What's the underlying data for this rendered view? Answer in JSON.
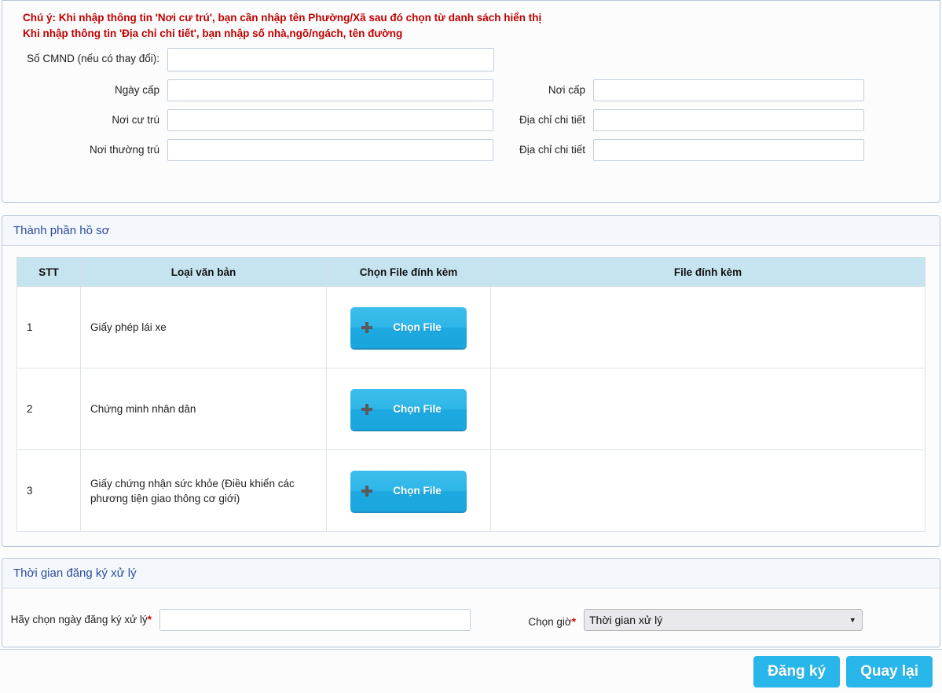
{
  "notice": {
    "line1": "Chú ý: Khi nhập thông tin 'Nơi cư trú', bạn cần nhập tên Phường/Xã sau đó chọn từ danh sách hiển thị",
    "line2": "Khi nhập thông tin 'Địa chỉ chi tiết', bạn nhập số nhà,ngõ/ngách, tên đường",
    "color": "#c00000"
  },
  "personal_form": {
    "fields": [
      {
        "label": "Số CMND (nếu có thay đổi):",
        "value": "",
        "placeholder": ""
      },
      {
        "label": "Ngày cấp",
        "value": "",
        "placeholder": ""
      },
      {
        "label": "Nơi cấp",
        "value": "",
        "placeholder": ""
      },
      {
        "label": "Nơi cư trú",
        "value": "",
        "placeholder": ""
      },
      {
        "label": "Địa chỉ chi tiết",
        "value": "",
        "placeholder": ""
      },
      {
        "label": "Nơi thường trú",
        "value": "",
        "placeholder": ""
      },
      {
        "label": "Địa chỉ chi tiết",
        "value": "",
        "placeholder": ""
      }
    ]
  },
  "documents_panel": {
    "title": "Thành phần hồ sơ",
    "table": {
      "columns": [
        "STT",
        "Loại văn bản",
        "Chọn File đính kèm",
        "File đính kèm"
      ],
      "choose_file_label": "Chọn File",
      "rows": [
        {
          "stt": "1",
          "loai": "Giấy phép lái xe",
          "file": ""
        },
        {
          "stt": "2",
          "loai": "Chứng minh nhân dân",
          "file": ""
        },
        {
          "stt": "3",
          "loai": "Giấy chứng nhận sức khỏe (Điều khiển các phương tiện giao thông cơ giới)",
          "file": ""
        }
      ]
    }
  },
  "schedule_panel": {
    "title": "Thời gian đăng ký xử lý",
    "date_label": "Hãy chọn ngày đăng ký xử lý",
    "date_required": "*",
    "date_value": "",
    "date_placeholder": "",
    "hour_label": "Chọn giờ",
    "hour_required": "*",
    "hour_selected": "Thời gian xử lý",
    "hour_options": [
      "Thời gian xử lý"
    ]
  },
  "footer": {
    "submit_label": "Đăng ký",
    "back_label": "Quay lại"
  },
  "icons": {
    "plus": "plus-icon",
    "chevron_down": "chevron-down-icon"
  },
  "theme": {
    "accent": "#29b6ea",
    "panel_title": "#2b4b9b",
    "table_header_bg": "#c5e4f0",
    "notice": "#c00000"
  }
}
